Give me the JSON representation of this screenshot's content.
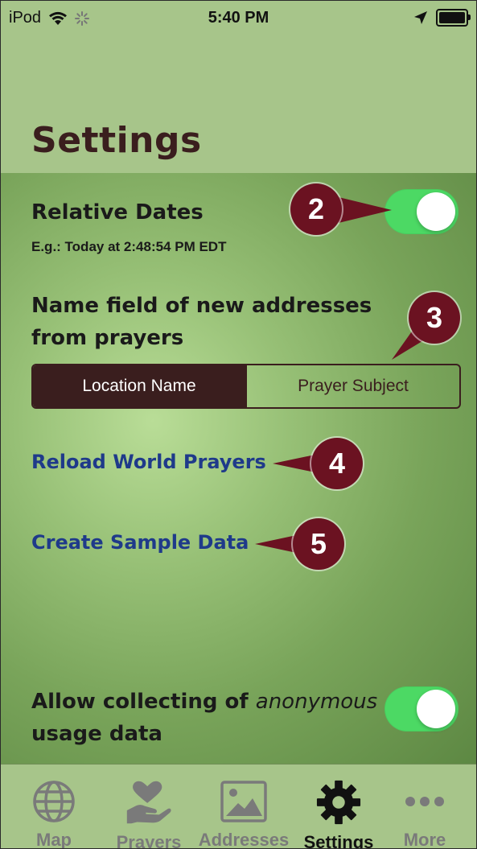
{
  "status_bar": {
    "carrier": "iPod",
    "time": "5:40 PM"
  },
  "header": {
    "title": "Settings"
  },
  "settings": {
    "relative_dates": {
      "label": "Relative Dates",
      "example": "E.g.: Today at 2:48:54 PM EDT",
      "enabled": true
    },
    "name_field": {
      "label_line1": "Name field of new addresses",
      "label_line2": "from prayers",
      "options": [
        "Location Name",
        "Prayer Subject"
      ],
      "selected": "Location Name"
    },
    "reload_link": "Reload World Prayers",
    "sample_link": "Create Sample Data",
    "anonymous": {
      "label_prefix": "Allow collecting of ",
      "label_italic": "anonymous",
      "label_line2": "usage data",
      "enabled": true
    }
  },
  "callouts": [
    "2",
    "3",
    "4",
    "5"
  ],
  "tabs": [
    {
      "label": "Map",
      "icon": "globe-icon",
      "active": false
    },
    {
      "label": "Prayers",
      "icon": "hand-heart-icon",
      "active": false
    },
    {
      "label": "Addresses",
      "icon": "image-icon",
      "active": false
    },
    {
      "label": "Settings",
      "icon": "gear-icon",
      "active": true
    },
    {
      "label": "More",
      "icon": "ellipsis-icon",
      "active": false
    }
  ],
  "colors": {
    "background": "#a7c58a",
    "title": "#3a1e1e",
    "link": "#1f3a8a",
    "toggle_on": "#4cd964",
    "callout": "#6b1221"
  }
}
